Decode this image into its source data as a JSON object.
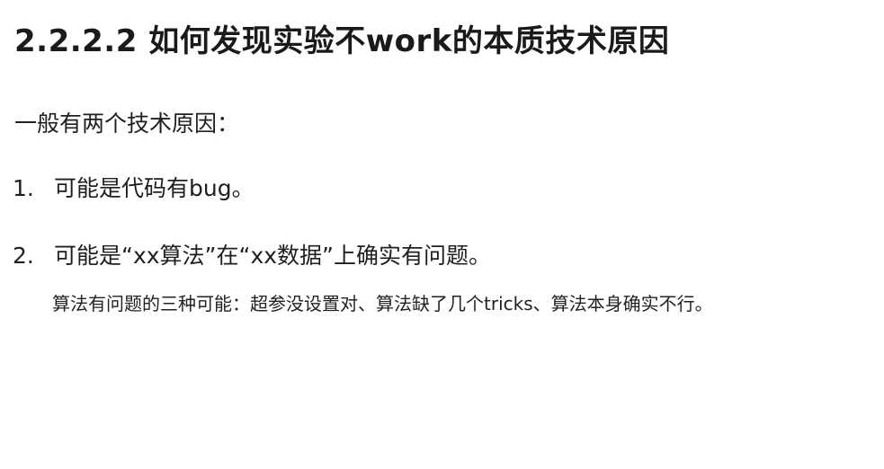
{
  "document": {
    "title": "2.2.2.2 如何发现实验不work的本质技术原因",
    "intro": "一般有两个技术原因：",
    "items": [
      {
        "number": "1.",
        "text": "可能是代码有bug。"
      },
      {
        "number": "2.",
        "text": "可能是“xx算法”在“xx数据”上确实有问题。",
        "note": "算法有问题的三种可能：超参没设置对、算法缺了几个tricks、算法本身确实不行。"
      }
    ]
  }
}
